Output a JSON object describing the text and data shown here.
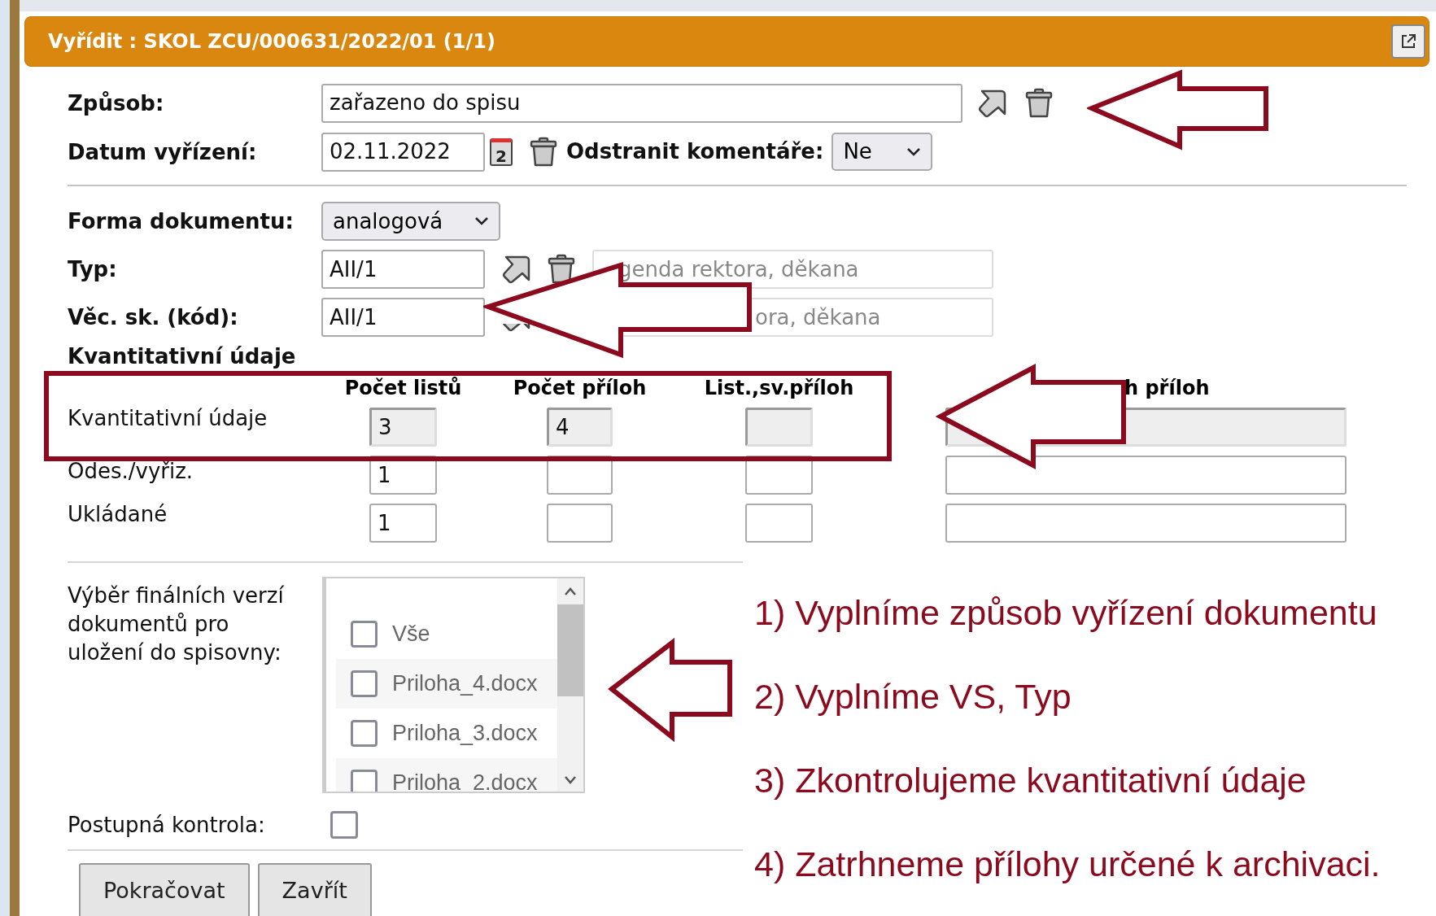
{
  "dialog": {
    "title": "Vyřídit : SKOL ZCU/000631/2022/01 (1/1)"
  },
  "form": {
    "zpusob": {
      "label": "Způsob:",
      "value": "zařazeno do spisu"
    },
    "datum": {
      "label": "Datum vyřízení:",
      "value": "02.11.2022",
      "calendar_day": "2"
    },
    "odstranit": {
      "label": "Odstranit komentáře:",
      "value": "Ne"
    },
    "forma": {
      "label": "Forma dokumentu:",
      "value": "analogová"
    },
    "typ": {
      "label": "Typ:",
      "code": "AII/1",
      "description": "genda rektora, děkana"
    },
    "vec": {
      "label": "Věc. sk. (kód):",
      "code": "AII/1",
      "description": "ora, děkana"
    }
  },
  "quantities": {
    "title": "Kvantitativní údaje",
    "columns": [
      "Počet listů",
      "Počet příloh",
      "List.,sv.příloh",
      "h příloh"
    ],
    "rows": [
      {
        "label": "Kvantitativní údaje",
        "readonly": true,
        "cells": [
          "3",
          "4",
          null,
          null
        ]
      },
      {
        "label": "Odes./vyřiz.",
        "readonly": false,
        "cells": [
          "1",
          null,
          null,
          null
        ]
      },
      {
        "label": "Ukládané",
        "readonly": false,
        "cells": [
          "1",
          null,
          null,
          null
        ]
      }
    ]
  },
  "versions": {
    "label": "Výběr finálních verzí dokumentů pro uložení do spisovny:",
    "items": [
      {
        "label": "Vše",
        "checked": false
      },
      {
        "label": "Priloha_4.docx",
        "checked": false
      },
      {
        "label": "Priloha_3.docx",
        "checked": false
      },
      {
        "label": "Priloha_2.docx",
        "checked": false
      }
    ]
  },
  "postupna": {
    "label": "Postupná kontrola:",
    "checked": false
  },
  "buttons": [
    "Pokračovat",
    "Zavřít"
  ],
  "annotations": {
    "steps": [
      "1) Vyplníme způsob vyřízení dokumentu",
      "2) Vyplníme VS, Typ",
      "3) Zkontrolujeme kvantitativní údaje",
      "4) Zatrhneme přílohy určené k archivaci."
    ]
  }
}
